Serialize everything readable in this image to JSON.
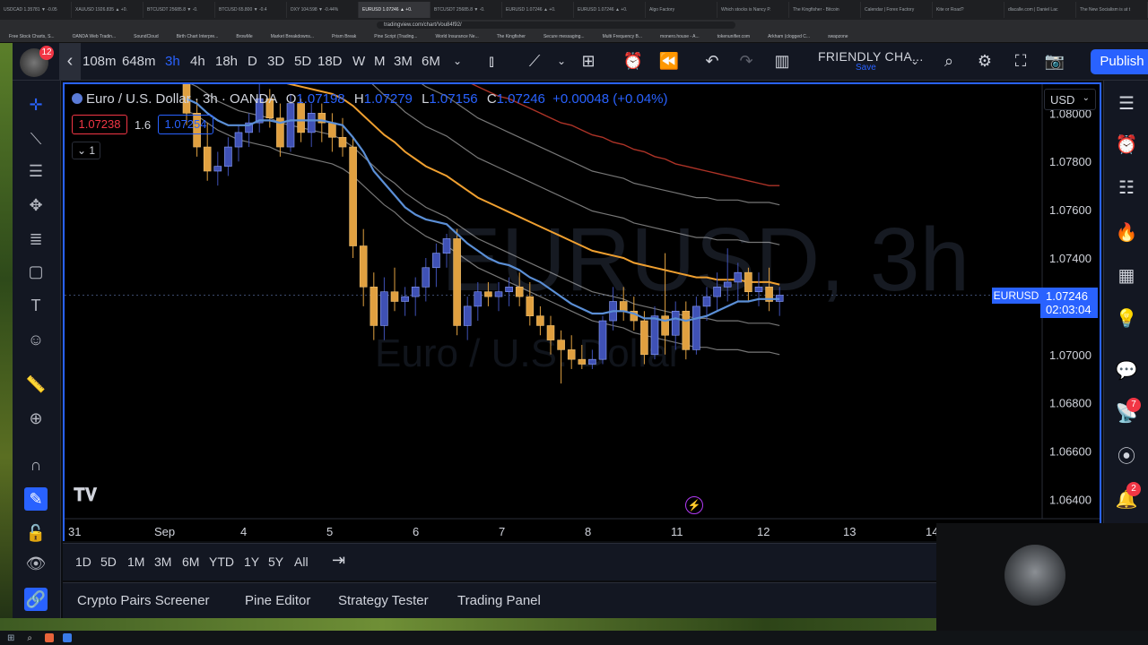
{
  "browser": {
    "tabs": [
      "USDCAD 1.35781 ▼ -0.05",
      "XAUUSD 1926.835 ▲ +0.",
      "BTCUSDT 25685.8 ▼ -0.",
      "BTCUSD 65.800 ▼ -0.4",
      "DXY 104.598 ▼ -0.44%",
      "EURUSD 1.07246 ▲ +0.",
      "BTCUSDT 25685.8 ▼ -0.",
      "EURUSD 1.07246 ▲ +0.",
      "EURUSD 1.07246 ▲ +0.",
      "Algo Factory",
      "Which stocks is Nancy P.",
      "The Kingfisher - Bitcoin",
      "Calendar | Forex Factory",
      "Kite or Road?",
      "dlacalle.com | Daniel Lac",
      "The New Socialism is at t"
    ],
    "url": "tradingview.com/chart/Vou84f92/",
    "bookmarks": [
      "Free Stock Charts, S...",
      "OANDA Web Tradin...",
      "SoundCloud",
      "Birth Chart Interpre...",
      "BrowMe",
      "Market Breakdowns...",
      "Prism Break",
      "Pine Script (Trading...",
      "World Insurance Ne...",
      "The Kingfisher",
      "Secure messaging...",
      "Multi Frequency B...",
      "monero.house - A...",
      "tokenunifier.com",
      "Arkham (clogged C...",
      "swapzone"
    ]
  },
  "toolbar": {
    "avatar_badge": "12",
    "intervals": [
      "108m",
      "648m",
      "3h",
      "4h",
      "18h",
      "D",
      "3D",
      "5D",
      "18D",
      "W",
      "M",
      "3M",
      "6M"
    ],
    "selected_interval": "3h",
    "layout_name": "FRIENDLY CHA...",
    "save_label": "Save",
    "publish_label": "Publish"
  },
  "legend": {
    "symbol": "Euro / U.S. Dollar · 3h · OANDA",
    "open_label": "O",
    "open": "1.07198",
    "high_label": "H",
    "high": "1.07279",
    "low_label": "L",
    "low": "1.07156",
    "close_label": "C",
    "close": "1.07246",
    "change": "+0.00048 (+0.04%)",
    "sell_price": "1.07238",
    "spread": "1.6",
    "buy_price": "1.07254",
    "indicator_count": "1"
  },
  "watermark": {
    "line1": "EURUSD, 3h",
    "line2": "Euro / U.S. Dollar"
  },
  "price_scale": {
    "currency": "USD",
    "ticks": [
      "1.08000",
      "1.07800",
      "1.07600",
      "1.07400",
      "1.07200",
      "1.07000",
      "1.06800",
      "1.06600",
      "1.06400"
    ],
    "current_symbol": "EURUSD",
    "current_price": "1.07246",
    "countdown": "02:03:04"
  },
  "time_scale": {
    "labels": [
      "31",
      "Sep",
      "4",
      "5",
      "6",
      "7",
      "8",
      "11",
      "12",
      "13",
      "14"
    ]
  },
  "range_buttons": [
    "1D",
    "5D",
    "1M",
    "3M",
    "6M",
    "YTD",
    "1Y",
    "5Y",
    "All"
  ],
  "bottom_tabs": [
    "Crypto Pairs Screener",
    "Pine Editor",
    "Strategy Tester",
    "Trading Panel"
  ],
  "right_badges": {
    "ideas": "7",
    "notifications": "2"
  },
  "colors": {
    "accent": "#2962ff",
    "bull": "#3f51b5",
    "bear": "#e0a040",
    "ema_fast": "#5b8fd6",
    "ema_slow": "#f0a030",
    "ema_long": "#c0392b",
    "band": "#d8d8d8"
  },
  "chart_data": {
    "type": "candlestick",
    "symbol": "EURUSD",
    "ylim": [
      1.0632,
      1.0812
    ],
    "candles": [
      [
        1.0812,
        1.0815,
        1.0795,
        1.08
      ],
      [
        1.08,
        1.0806,
        1.0782,
        1.0786
      ],
      [
        1.0786,
        1.0796,
        1.0772,
        1.0776
      ],
      [
        1.0776,
        1.0784,
        1.077,
        1.0778
      ],
      [
        1.0778,
        1.079,
        1.0774,
        1.0786
      ],
      [
        1.0786,
        1.0795,
        1.078,
        1.0792
      ],
      [
        1.0792,
        1.08,
        1.0786,
        1.0796
      ],
      [
        1.0796,
        1.0812,
        1.0792,
        1.0806
      ],
      [
        1.0806,
        1.081,
        1.0794,
        1.0798
      ],
      [
        1.0798,
        1.0804,
        1.0782,
        1.0786
      ],
      [
        1.0786,
        1.0808,
        1.0784,
        1.0804
      ],
      [
        1.0804,
        1.0806,
        1.0788,
        1.0792
      ],
      [
        1.0792,
        1.0804,
        1.0786,
        1.08
      ],
      [
        1.08,
        1.0804,
        1.0788,
        1.0796
      ],
      [
        1.0796,
        1.08,
        1.0784,
        1.079
      ],
      [
        1.079,
        1.0798,
        1.0782,
        1.0786
      ],
      [
        1.0786,
        1.079,
        1.074,
        1.0745
      ],
      [
        1.0745,
        1.0752,
        1.072,
        1.0728
      ],
      [
        1.0728,
        1.0734,
        1.0706,
        1.0712
      ],
      [
        1.0712,
        1.0732,
        1.0706,
        1.0726
      ],
      [
        1.0726,
        1.0736,
        1.0718,
        1.0722
      ],
      [
        1.0722,
        1.0728,
        1.0716,
        1.0724
      ],
      [
        1.0724,
        1.0732,
        1.0716,
        1.0728
      ],
      [
        1.0728,
        1.074,
        1.0722,
        1.0736
      ],
      [
        1.0736,
        1.0746,
        1.0728,
        1.0742
      ],
      [
        1.0742,
        1.075,
        1.0736,
        1.0748
      ],
      [
        1.0748,
        1.0752,
        1.0708,
        1.0712
      ],
      [
        1.0712,
        1.0724,
        1.0706,
        1.072
      ],
      [
        1.072,
        1.073,
        1.0714,
        1.0726
      ],
      [
        1.0726,
        1.073,
        1.072,
        1.0724
      ],
      [
        1.0724,
        1.073,
        1.0718,
        1.0726
      ],
      [
        1.0726,
        1.0732,
        1.072,
        1.0728
      ],
      [
        1.0728,
        1.0734,
        1.072,
        1.0724
      ],
      [
        1.0724,
        1.073,
        1.0712,
        1.0716
      ],
      [
        1.0716,
        1.072,
        1.0708,
        1.0712
      ],
      [
        1.0712,
        1.0716,
        1.07,
        1.0706
      ],
      [
        1.0706,
        1.071,
        1.0688,
        1.0702
      ],
      [
        1.0702,
        1.0708,
        1.0694,
        1.0698
      ],
      [
        1.0698,
        1.0704,
        1.0694,
        1.0696
      ],
      [
        1.0696,
        1.0702,
        1.0694,
        1.0698
      ],
      [
        1.0698,
        1.0716,
        1.0696,
        1.0714
      ],
      [
        1.0714,
        1.0728,
        1.071,
        1.0722
      ],
      [
        1.0722,
        1.0728,
        1.0714,
        1.0718
      ],
      [
        1.0718,
        1.0724,
        1.071,
        1.0714
      ],
      [
        1.0714,
        1.0718,
        1.0696,
        1.07
      ],
      [
        1.07,
        1.072,
        1.0698,
        1.0716
      ],
      [
        1.0716,
        1.0742,
        1.07,
        1.0708
      ],
      [
        1.0708,
        1.0722,
        1.0702,
        1.0718
      ],
      [
        1.0718,
        1.0722,
        1.0698,
        1.0702
      ],
      [
        1.0702,
        1.0724,
        1.07,
        1.072
      ],
      [
        1.072,
        1.0728,
        1.0714,
        1.0724
      ],
      [
        1.0724,
        1.0734,
        1.0718,
        1.0728
      ],
      [
        1.0728,
        1.0744,
        1.0722,
        1.073
      ],
      [
        1.073,
        1.0738,
        1.0722,
        1.0734
      ],
      [
        1.0734,
        1.0736,
        1.0722,
        1.0726
      ],
      [
        1.0726,
        1.0734,
        1.072,
        1.0728
      ],
      [
        1.0728,
        1.0736,
        1.0718,
        1.0722
      ],
      [
        1.0722,
        1.0728,
        1.0716,
        1.07246
      ]
    ],
    "ema_fast": [
      1.0806,
      1.0804,
      1.08,
      1.0797,
      1.0795,
      1.0795,
      1.0795,
      1.0797,
      1.0797,
      1.0796,
      1.0797,
      1.0797,
      1.0797,
      1.0797,
      1.0796,
      1.0795,
      1.079,
      1.0784,
      1.0776,
      1.0771,
      1.0766,
      1.0761,
      1.0758,
      1.0756,
      1.0755,
      1.0754,
      1.075,
      1.0746,
      1.0743,
      1.074,
      1.0738,
      1.0737,
      1.0735,
      1.0732,
      1.073,
      1.0727,
      1.0724,
      1.0721,
      1.0719,
      1.0717,
      1.0717,
      1.0718,
      1.0718,
      1.0717,
      1.0715,
      1.0715,
      1.0714,
      1.0715,
      1.0714,
      1.0715,
      1.0716,
      1.0718,
      1.072,
      1.0722,
      1.0722,
      1.0723,
      1.0723,
      1.0723
    ],
    "ema_slow": [
      1.083,
      1.0828,
      1.0825,
      1.0822,
      1.082,
      1.0818,
      1.0817,
      1.0816,
      1.0815,
      1.0813,
      1.0812,
      1.0811,
      1.081,
      1.0809,
      1.0808,
      1.0806,
      1.0803,
      1.0799,
      1.0795,
      1.0791,
      1.0788,
      1.0784,
      1.0781,
      1.0778,
      1.0776,
      1.0774,
      1.0771,
      1.0768,
      1.0765,
      1.0763,
      1.0761,
      1.0759,
      1.0757,
      1.0755,
      1.0753,
      1.0751,
      1.0749,
      1.0747,
      1.0745,
      1.0743,
      1.0742,
      1.0741,
      1.074,
      1.0738,
      1.0737,
      1.0736,
      1.0735,
      1.0734,
      1.0733,
      1.0732,
      1.0732,
      1.0731,
      1.0731,
      1.0731,
      1.073,
      1.073,
      1.073,
      1.0729
    ],
    "ema_long": [
      1.086,
      1.0858,
      1.0856,
      1.0854,
      1.0852,
      1.085,
      1.0849,
      1.0847,
      1.0846,
      1.0844,
      1.0843,
      1.0842,
      1.0841,
      1.0839,
      1.0838,
      1.0837,
      1.0835,
      1.0833,
      1.0831,
      1.0829,
      1.0827,
      1.0825,
      1.0823,
      1.0821,
      1.0819,
      1.0817,
      1.0815,
      1.0813,
      1.0811,
      1.0809,
      1.0807,
      1.0806,
      1.0804,
      1.0802,
      1.08,
      1.0798,
      1.0796,
      1.0795,
      1.0793,
      1.0791,
      1.079,
      1.0788,
      1.0787,
      1.0785,
      1.0784,
      1.0782,
      1.0781,
      1.0779,
      1.0778,
      1.0777,
      1.0776,
      1.0775,
      1.0774,
      1.0773,
      1.0772,
      1.0771,
      1.077,
      1.077
    ],
    "band_offsets": [
      0.00165,
      0.0033,
      -0.0017,
      -0.0029
    ]
  }
}
